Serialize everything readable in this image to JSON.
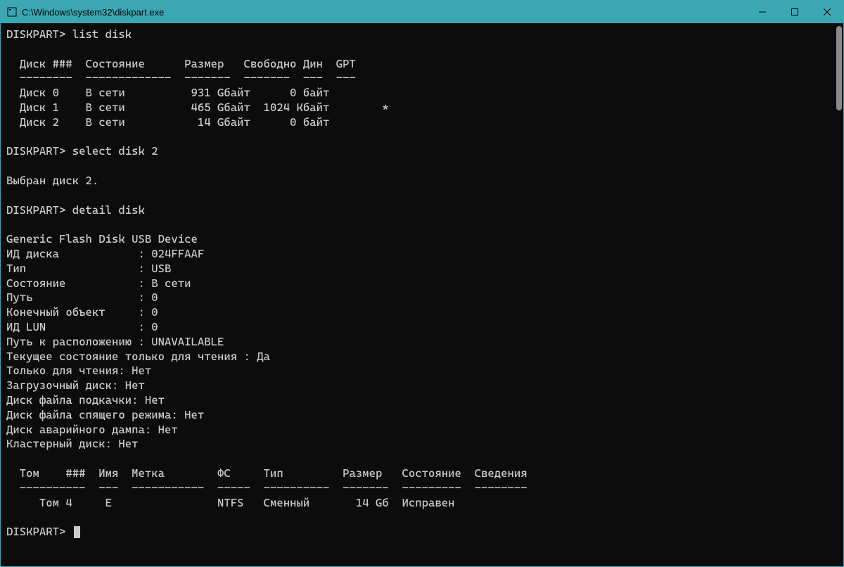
{
  "window": {
    "title": "C:\\Windows\\system32\\diskpart.exe"
  },
  "terminal": {
    "prompt1": "DISKPART> list disk",
    "disk_header": "  Диск ###  Состояние      Размер   Свободно Дин  GPT",
    "disk_separator": "  --------  -------------  -------  -------  ---  ---",
    "disk_row_0": "  Диск 0    В сети          931 Gбайт      0 байт",
    "disk_row_1": "  Диск 1    В сети          465 Gбайт  1024 Kбайт        *",
    "disk_row_2": "  Диск 2    В сети           14 Gбайт      0 байт",
    "prompt2": "DISKPART> select disk 2",
    "selected_msg": "Выбран диск 2.",
    "prompt3": "DISKPART> detail disk",
    "detail_name": "Generic Flash Disk USB Device",
    "detail_id": "ИД диска            : 024FFAAF",
    "detail_type": "Тип                 : USB",
    "detail_status": "Состояние           : В сети",
    "detail_path": "Путь                : 0",
    "detail_target": "Конечный объект     : 0",
    "detail_lun": "ИД LUN              : 0",
    "detail_locpath": "Путь к расположению : UNAVAILABLE",
    "detail_ro_state": "Текущее состояние только для чтения : Да",
    "detail_ro": "Только для чтения: Нет",
    "detail_boot": "Загрузочный диск: Нет",
    "detail_pagefile": "Диск файла подкачки: Нет",
    "detail_hibernate": "Диск файла спящего режима: Нет",
    "detail_crashdump": "Диск аварийного дампа: Нет",
    "detail_cluster": "Кластерный диск: Нет",
    "vol_header": "  Том    ###  Имя  Метка        ФС     Тип         Размер   Состояние  Сведения",
    "vol_separator": "  ----------  ---  -----------  -----  ----------  -------  ---------  --------",
    "vol_row": "     Том 4     E                NTFS   Сменный       14 Gб  Исправен",
    "prompt4": "DISKPART> "
  }
}
